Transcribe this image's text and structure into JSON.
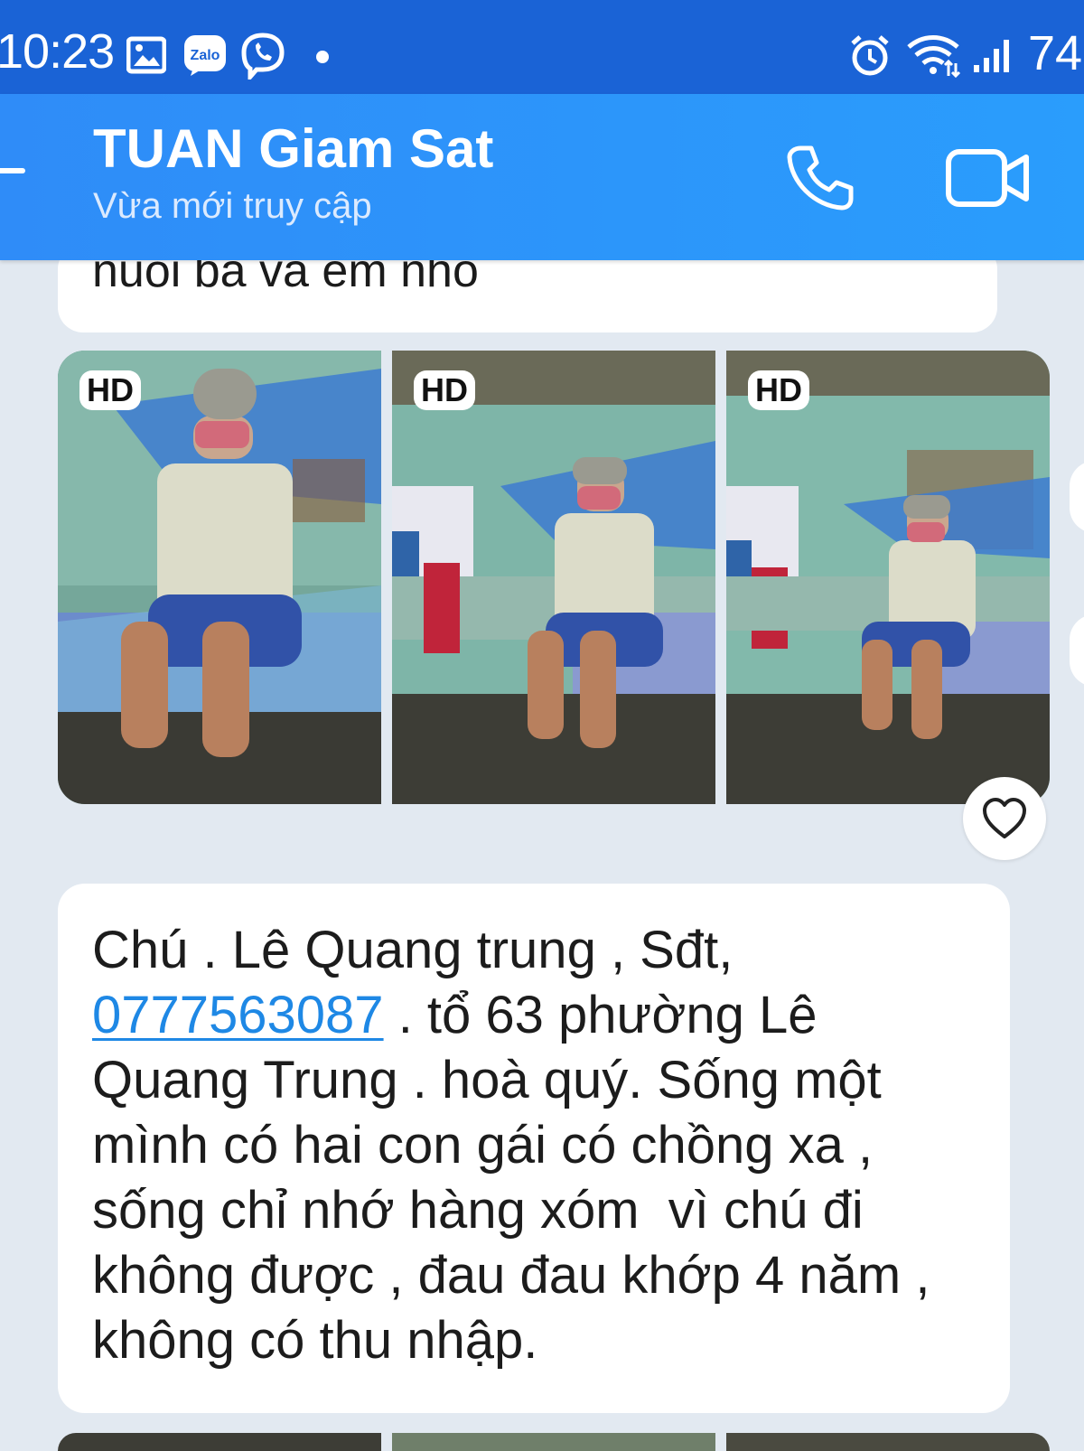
{
  "status_bar": {
    "time": "10:23",
    "battery": "74",
    "icons": [
      "gallery-icon",
      "zalo-icon",
      "viber-icon",
      "alarm-icon",
      "wifi-icon",
      "signal-icon"
    ],
    "zalo_label": "Zalo"
  },
  "header": {
    "title": "TUAN Giam Sat",
    "subtitle": "Vừa mới truy cập",
    "icons": [
      "back-icon",
      "phone-icon",
      "video-call-icon"
    ]
  },
  "previous_message": {
    "text": "nuôi ba   và em nhỏ"
  },
  "photos": [
    {
      "badge": "HD"
    },
    {
      "badge": "HD"
    },
    {
      "badge": "HD"
    }
  ],
  "message": {
    "part1": "Chú . Lê Quang trung , Sđt, ",
    "phone": "0777563087",
    "part2": " . tổ 63 phường Lê Quang Trung . hoà quý. Sống một mình có hai con gái có chồng xa , sống chỉ nhớ hàng xóm  vì chú đi không được , đau đau khớp 4 năm , không có thu nhập."
  },
  "colors": {
    "status_bar": "#1a63d6",
    "header": "#2f8cf8",
    "background": "#e2e9f1",
    "link": "#1e88e5"
  }
}
